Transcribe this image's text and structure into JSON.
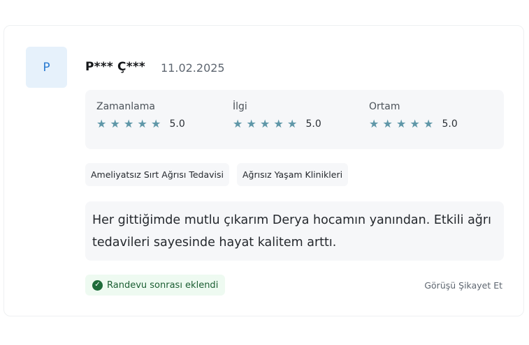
{
  "review": {
    "avatar_initial": "P",
    "author": "P*** Ç***",
    "date": "11.02.2025",
    "ratings": [
      {
        "label": "Zamanlama",
        "score": "5.0",
        "stars": 5
      },
      {
        "label": "İlgi",
        "score": "5.0",
        "stars": 5
      },
      {
        "label": "Ortam",
        "score": "5.0",
        "stars": 5
      }
    ],
    "tags": [
      "Ameliyatsız Sırt Ağrısı Tedavisi",
      "Ağrısız Yaşam Klinikleri"
    ],
    "comment": "Her gittiğimde mutlu çıkarım Derya hocamın yanından. Etkili ağrı tedavileri sayesinde hayat kalitem arttı.",
    "badge": "Randevu sonrası eklendi",
    "report_link": "Görüşü Şikayet Et"
  },
  "colors": {
    "star": "#5f97a8",
    "badge_bg": "#eefaf1",
    "badge_icon": "#1e6b3a",
    "avatar_bg": "#e6f1fb",
    "avatar_text": "#2a7bd0"
  },
  "icons": {
    "star": "star-icon",
    "badge": "check-circle-icon"
  }
}
